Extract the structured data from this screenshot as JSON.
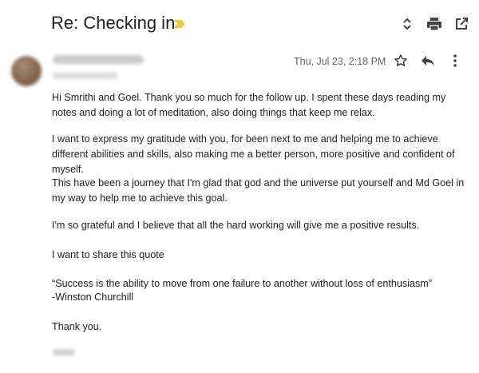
{
  "email": {
    "subject": "Re: Checking in",
    "date": "Thu, Jul 23, 2:18 PM",
    "body": [
      "Hi Smrithi and Goel. Thank you so much for the follow up. I spent these days reading my notes and doing a lot of meditation, also doing things that keep me relax.",
      "I want to express my gratitude with you, for been next to me and helping me to achieve different abilities and skills, also making me a better person, more positive and confident of myself.",
      "This have been a journey that I'm glad that god and the universe put yourself and Md Goel  in my way to help me to achieve this goal.",
      "I'm so grateful and I believe that all the hard working will give me a positive results.",
      "I want to share this quote",
      "“Success is the ability to move from one failure to another without loss of enthusiasm”",
      "-Winston Churchill",
      "Thank you."
    ]
  },
  "icons": {
    "importance": "importance-marker-icon",
    "expand": "expand-collapse-icon",
    "print": "print-icon",
    "open_new_window": "open-in-new-window-icon",
    "star": "star-icon",
    "reply": "reply-icon",
    "more": "more-vert-icon"
  },
  "colors": {
    "importance": "#f4c542",
    "text": "#222222",
    "muted": "#5f6368"
  }
}
